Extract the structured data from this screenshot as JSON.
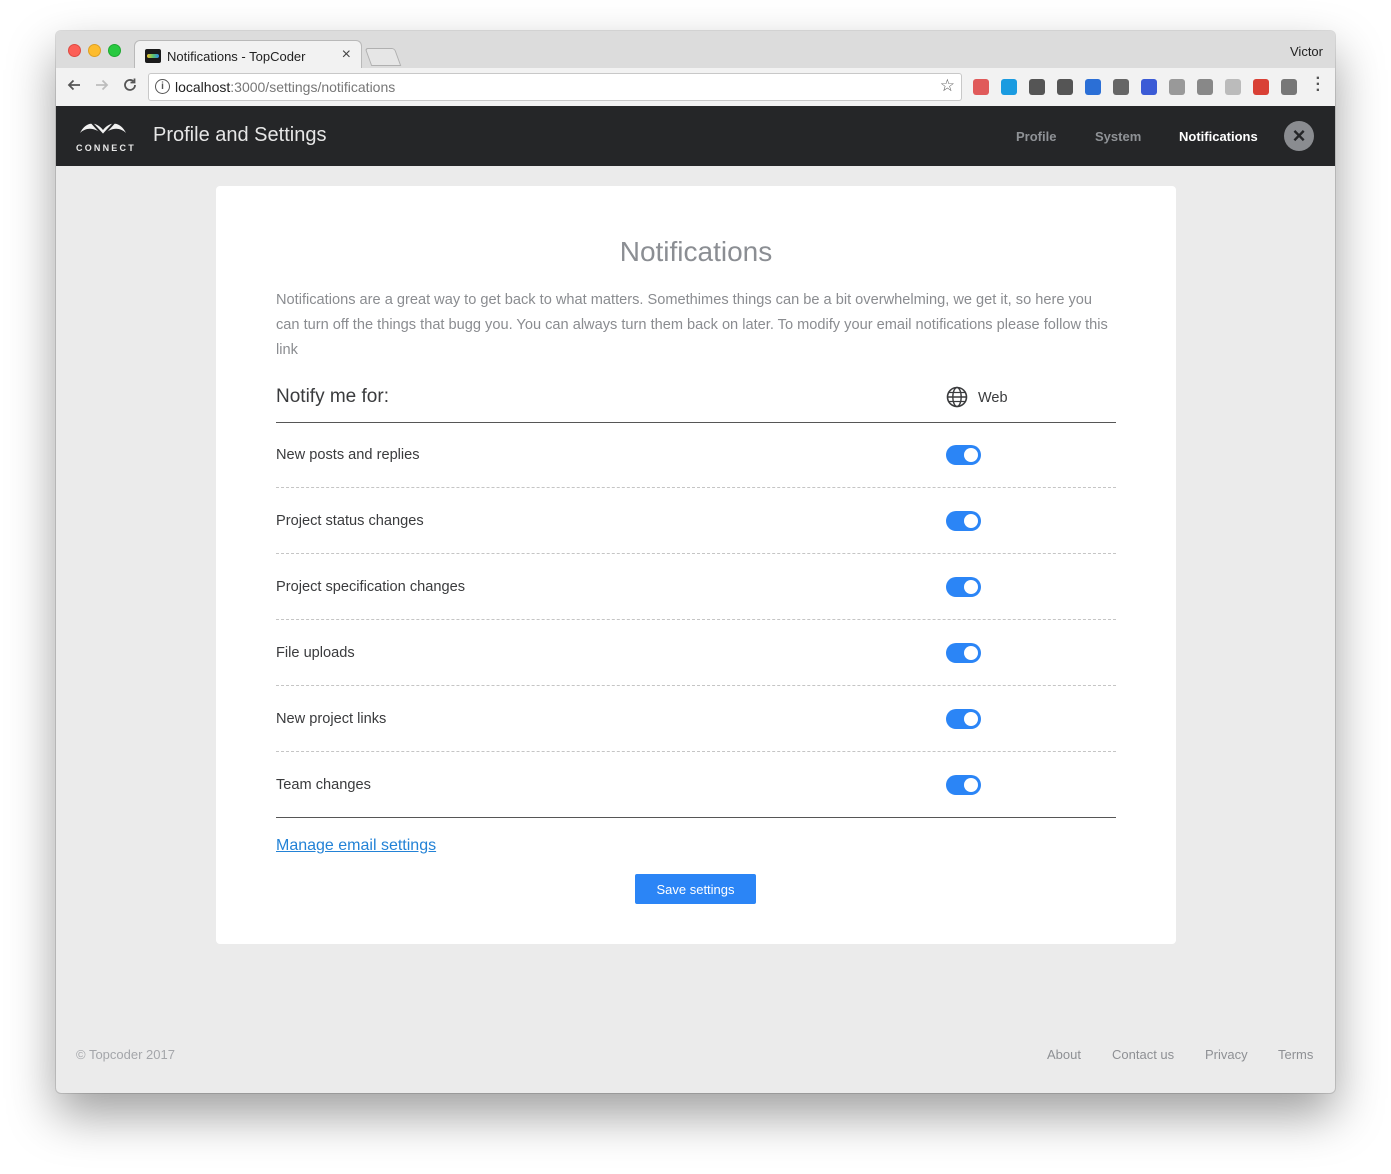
{
  "browser": {
    "tab_title": "Notifications - TopCoder",
    "tab_close": "×",
    "profile_name": "Victor",
    "url_host": "localhost",
    "url_rest": ":3000/settings/notifications",
    "info_icon": "i",
    "star_icon": "☆",
    "extension_colors": [
      "#e05a5a",
      "#1a9be0",
      "#555555",
      "#555555",
      "#2b6fd6",
      "#666666",
      "#3b5bd6",
      "#999999",
      "#888888",
      "#bbbbbb",
      "#d94035",
      "#777777"
    ]
  },
  "app": {
    "logo_text": "CONNECT",
    "page_title": "Profile and Settings",
    "nav": {
      "profile": "Profile",
      "system": "System",
      "notifications": "Notifications"
    },
    "close_glyph": "×",
    "accent_color": "#2b85f6",
    "header_bg": "#252628"
  },
  "card": {
    "title": "Notifications",
    "description": "Notifications are a great way to get back to what matters. Somethimes things can be a bit overwhelming, we get it, so here you can turn off the things that bugg you. You can always turn them back on later. To modify your email notifications please follow this link",
    "notify_label": "Notify me for:",
    "web_label": "Web",
    "settings": [
      {
        "label": "New posts and replies",
        "enabled": true
      },
      {
        "label": "Project status changes",
        "enabled": true
      },
      {
        "label": "Project specification changes",
        "enabled": true
      },
      {
        "label": "File uploads",
        "enabled": true
      },
      {
        "label": "New project links",
        "enabled": true
      },
      {
        "label": "Team changes",
        "enabled": true
      }
    ],
    "manage_link": "Manage email settings",
    "save_label": "Save settings"
  },
  "footer": {
    "copyright": "© Topcoder 2017",
    "links": {
      "about": "About",
      "contact": "Contact us",
      "privacy": "Privacy",
      "terms": "Terms"
    }
  }
}
